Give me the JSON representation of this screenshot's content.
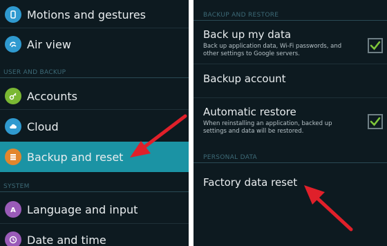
{
  "left_screen": {
    "items_top": [
      {
        "label": "Motions and gestures",
        "icon": "motion-icon"
      },
      {
        "label": "Air view",
        "icon": "air-view-icon"
      }
    ],
    "section_user": "USER AND BACKUP",
    "items_user": [
      {
        "label": "Accounts",
        "icon": "key-icon"
      },
      {
        "label": "Cloud",
        "icon": "cloud-icon"
      },
      {
        "label": "Backup and reset",
        "icon": "backup-icon",
        "selected": true
      }
    ],
    "section_system": "SYSTEM",
    "items_system": [
      {
        "label": "Language and input",
        "icon": "language-icon"
      },
      {
        "label": "Date and time",
        "icon": "clock-icon"
      }
    ]
  },
  "right_screen": {
    "section_backup": "BACKUP AND RESTORE",
    "backup_data": {
      "title": "Back up my data",
      "summary": "Back up application data, Wi-Fi passwords, and other settings to Google servers.",
      "checked": true
    },
    "backup_account": {
      "title": "Backup account"
    },
    "auto_restore": {
      "title": "Automatic restore",
      "summary": "When reinstalling an application, backed up settings and data will be restored.",
      "checked": true
    },
    "section_personal": "PERSONAL DATA",
    "factory_reset": {
      "title": "Factory data reset"
    }
  },
  "colors": {
    "background": "#0d1a20",
    "selected_row": "#1b93a4",
    "checkmark": "#7ec63a",
    "annotation_arrow": "#e0202a"
  }
}
